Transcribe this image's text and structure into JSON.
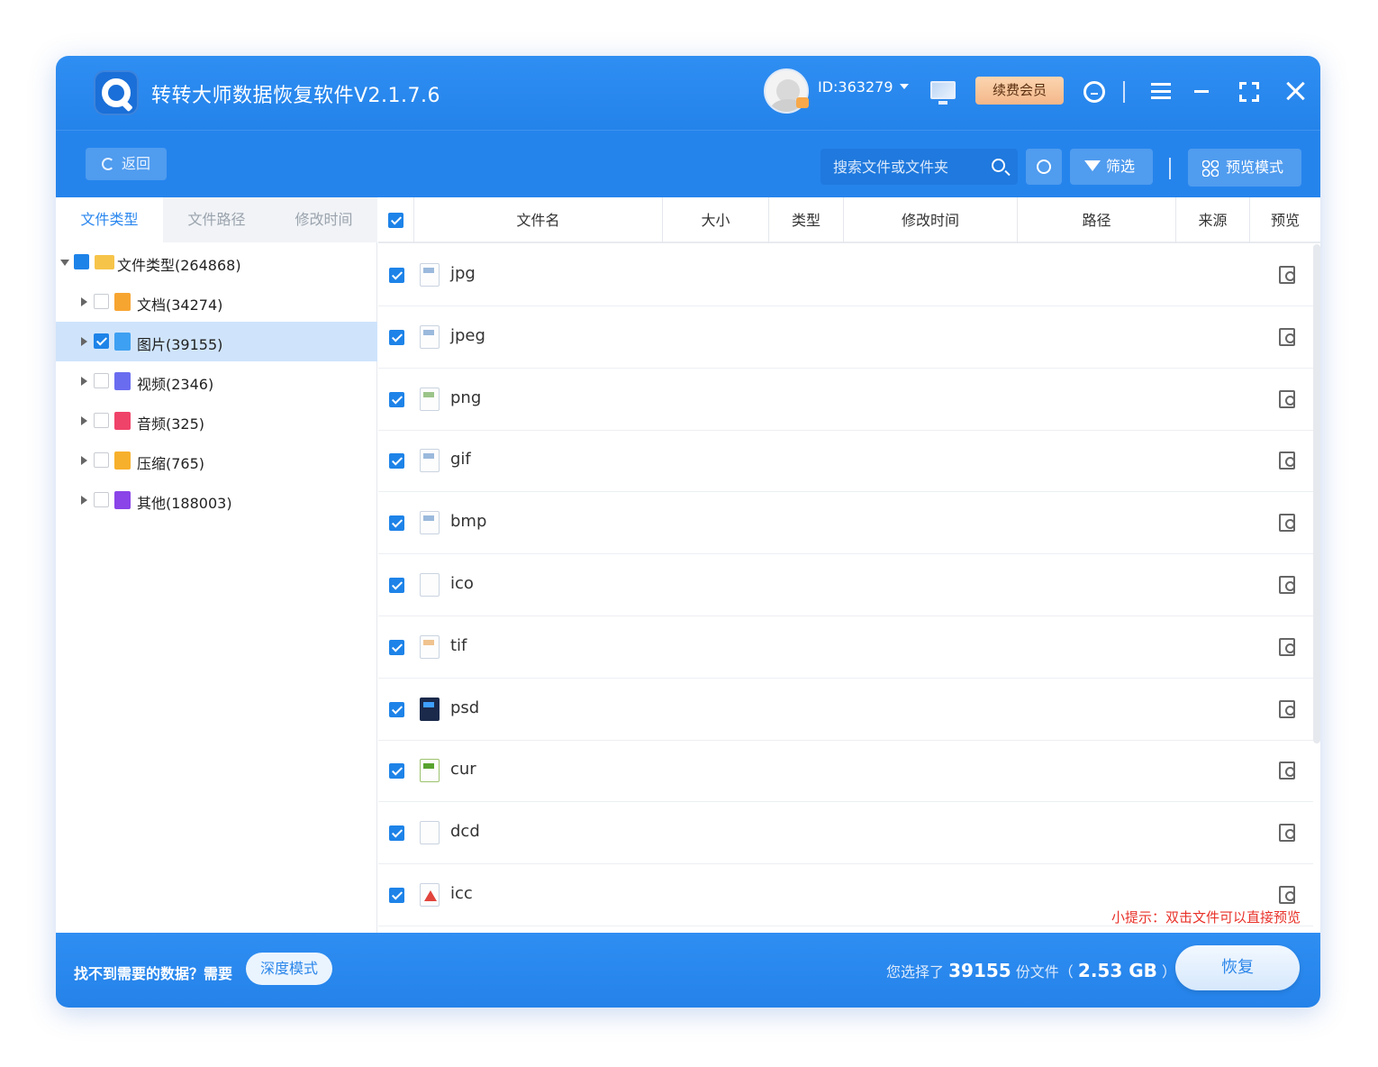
{
  "window": {
    "app_title": "转转大师数据恢复软件V2.1.7.6",
    "user_id": "ID:363279",
    "vip_label": "续费会员"
  },
  "toolbar": {
    "back_label": "返回",
    "search_placeholder": "搜索文件或文件夹",
    "filter_label": "筛选",
    "preview_mode_label": "预览模式"
  },
  "left_panel": {
    "tabs": [
      "文件类型",
      "文件路径",
      "修改时间"
    ],
    "active_tab": 0,
    "tree": [
      {
        "label": "文件类型(264868)",
        "checked": "partial",
        "expanded": true,
        "level": 0,
        "icon": "folder-icon",
        "color": "#f7c44a"
      },
      {
        "label": "文档(34274)",
        "checked": false,
        "level": 1,
        "icon": "document-icon",
        "color": "#f7a531"
      },
      {
        "label": "图片(39155)",
        "checked": true,
        "selected": true,
        "level": 1,
        "icon": "image-icon",
        "color": "#3ea0f2"
      },
      {
        "label": "视频(2346)",
        "checked": false,
        "level": 1,
        "icon": "video-icon",
        "color": "#6a6cf0"
      },
      {
        "label": "音频(325)",
        "checked": false,
        "level": 1,
        "icon": "audio-icon",
        "color": "#f0436a"
      },
      {
        "label": "压缩(765)",
        "checked": false,
        "level": 1,
        "icon": "zip-icon",
        "color": "#f7b02c"
      },
      {
        "label": "其他(188003)",
        "checked": false,
        "level": 1,
        "icon": "other-icon",
        "color": "#8a44e8"
      }
    ]
  },
  "table": {
    "columns": [
      "文件名",
      "大小",
      "类型",
      "修改时间",
      "路径",
      "来源",
      "预览"
    ],
    "rows": [
      {
        "name": "jpg",
        "icon": "jpg-file-icon",
        "kind": "jpg"
      },
      {
        "name": "jpeg",
        "icon": "jpeg-file-icon",
        "kind": "jpg"
      },
      {
        "name": "png",
        "icon": "png-file-icon",
        "kind": "png"
      },
      {
        "name": "gif",
        "icon": "gif-file-icon",
        "kind": "jpg"
      },
      {
        "name": "bmp",
        "icon": "bmp-file-icon",
        "kind": "jpg"
      },
      {
        "name": "ico",
        "icon": "ico-file-icon",
        "kind": "blank"
      },
      {
        "name": "tif",
        "icon": "tif-file-icon",
        "kind": "tif"
      },
      {
        "name": "psd",
        "icon": "psd-file-icon",
        "kind": "psd"
      },
      {
        "name": "cur",
        "icon": "cur-file-icon",
        "kind": "cur"
      },
      {
        "name": "dcd",
        "icon": "dcd-file-icon",
        "kind": "blank"
      },
      {
        "name": "icc",
        "icon": "icc-file-icon",
        "kind": "icc"
      }
    ],
    "tip": "小提示：双击文件可以直接预览"
  },
  "footer": {
    "not_found_text": "找不到需要的数据？需要",
    "deep_mode_label": "深度模式",
    "selected_prefix": "您选择了",
    "selected_count": "39155",
    "selected_unit": "份文件（",
    "selected_size": "2.53 GB",
    "selected_suffix": "）",
    "recover_label": "恢复"
  }
}
